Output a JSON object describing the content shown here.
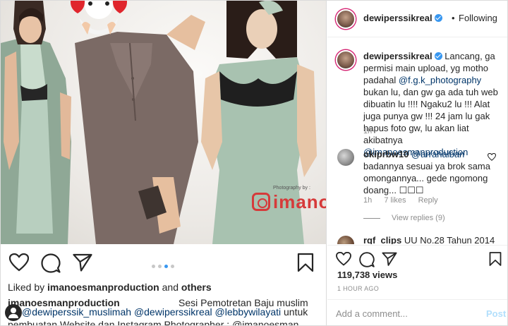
{
  "left_post": {
    "watermark": {
      "small": "Photography by :",
      "name": "imanoe"
    },
    "carousel": {
      "count": 4,
      "active_index": 2
    },
    "likes": {
      "prefix": "Liked by",
      "user": "imanoesmanproduction",
      "joiner": "and",
      "others": "others"
    },
    "caption": {
      "author": "imanoesmanproduction",
      "line1_text": "Sesi Pemotretan Baju muslim",
      "line2_mentions": [
        "@dewiperssik_muslimah",
        "@dewiperssikreal",
        "@lebbywilayati"
      ],
      "line2_tail": "untuk",
      "line3": "pembuatan Website dan Instagram Photographer : @imanoesman"
    }
  },
  "right_panel": {
    "header": {
      "username": "dewiperssikreal",
      "dot": "•",
      "follow_label": "Following"
    },
    "main_comment": {
      "username": "dewiperssikreal",
      "text_a": "Lancang, ga permisi main upload, yg motho padahal",
      "mention_a": "@f.g.k_photography",
      "text_b": "bukan lu, dan gw ga ada tuh web dibuatin lu !!!! Ngaku2 lu !!! Alat juga punya gw !!! 24 jam lu gak hapus foto gw, lu akan liat akibatnya",
      "mention_b": "@imanoesmanproduction",
      "time": "1h"
    },
    "reply_comment": {
      "username": "okiprbw10",
      "mention": "@arrahaiban",
      "text": "badannya sesuai ya brok sama omongannya... gede ngomong doang... ",
      "emoji": "☐☐☐",
      "time": "1h",
      "likes": "7 likes",
      "reply_label": "Reply",
      "view_replies": "View replies (9)"
    },
    "third_comment": {
      "username": "rqf_clips",
      "text": "UU No.28 Tahun 2014"
    },
    "views": "119,738 views",
    "posted": "1 HOUR AGO",
    "add_comment_placeholder": "Add a comment...",
    "post_label": "Post"
  },
  "colors": {
    "link": "#003569",
    "verified": "#3897f0",
    "muted": "#8e8e8e",
    "post_disabled": "#b2dffc",
    "watermark": "#d63a3a"
  }
}
